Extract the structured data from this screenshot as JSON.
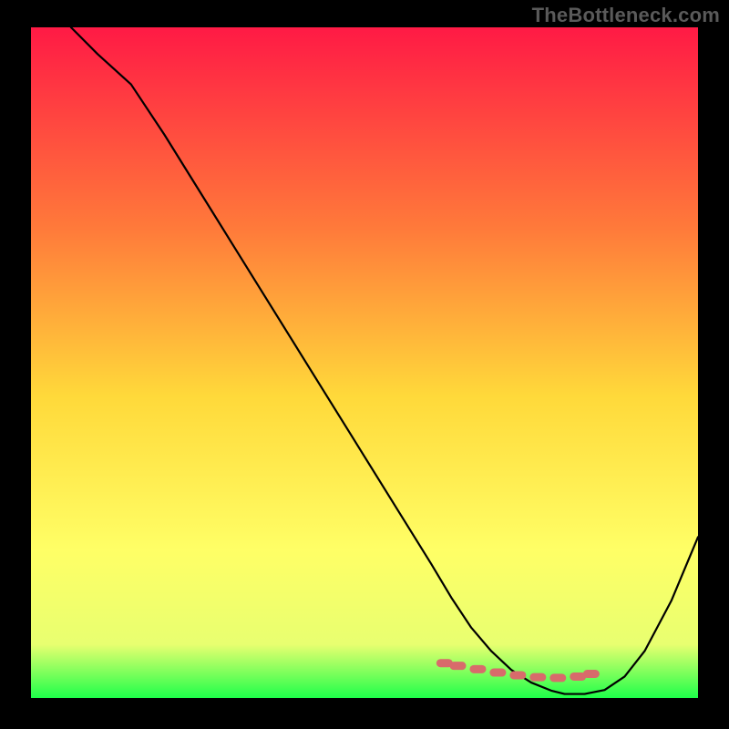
{
  "watermark": "TheBottleneck.com",
  "colors": {
    "background": "#000000",
    "gradient_top": "#ff1a45",
    "gradient_mid1": "#ff7a3a",
    "gradient_mid2": "#ffd93a",
    "gradient_mid3": "#ffff66",
    "gradient_bottom": "#1eff4a",
    "curve": "#000000",
    "marker": "#d86b6b"
  },
  "chart_data": {
    "type": "line",
    "title": "",
    "xlabel": "",
    "ylabel": "",
    "xlim": [
      0,
      100
    ],
    "ylim": [
      0,
      100
    ],
    "series": [
      {
        "name": "bottleneck-curve",
        "x": [
          6,
          10,
          15,
          20,
          25,
          30,
          35,
          40,
          45,
          50,
          55,
          60,
          63,
          66,
          69,
          72,
          75,
          78,
          80,
          83,
          86,
          89,
          92,
          96,
          100
        ],
        "values": [
          100,
          96,
          91.5,
          84,
          76,
          68,
          60,
          52,
          44,
          36,
          28,
          20,
          15,
          10.5,
          7,
          4.2,
          2.3,
          1.1,
          0.6,
          0.6,
          1.2,
          3.2,
          7,
          14.5,
          24
        ]
      }
    ],
    "markers": {
      "name": "optimal-region",
      "x": [
        62,
        64,
        67,
        70,
        73,
        76,
        79,
        82,
        84
      ],
      "values": [
        5.2,
        4.8,
        4.3,
        3.8,
        3.4,
        3.1,
        3.0,
        3.2,
        3.6
      ]
    },
    "gradient_stops_pct": [
      0,
      30,
      55,
      78,
      92,
      100
    ]
  }
}
